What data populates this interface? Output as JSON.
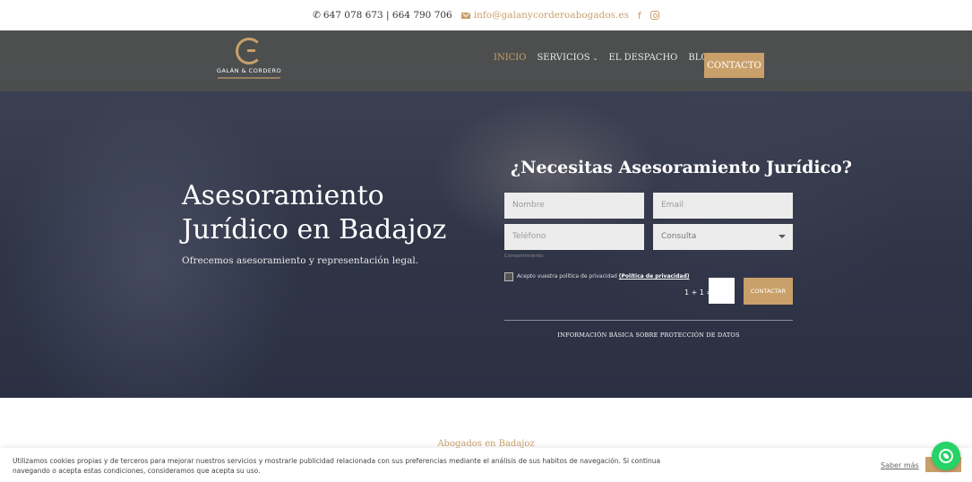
{
  "topbar": {
    "phone": "647 078 673 | 664 790 706",
    "email": "info@galanycorderoabogados.es",
    "facebook_icon": "f"
  },
  "logo": {
    "name": "GALÁN & CORDERO"
  },
  "nav": {
    "items": [
      {
        "label": "INICIO"
      },
      {
        "label": "SERVICIOS"
      },
      {
        "label": "EL DESPACHO"
      },
      {
        "label": "BLOG"
      }
    ],
    "contact_label": "CONTACTO",
    "chevron": "⌄"
  },
  "hero": {
    "title": "Asesoramiento Jurídico en Badajoz",
    "subtitle": "Ofrecemos asesoramiento y representación legal."
  },
  "form": {
    "title": "¿Necesitas Asesoramiento Jurídico?",
    "name_placeholder": "Nombre",
    "email_placeholder": "Email",
    "phone_placeholder": "Teléfono",
    "query_value": "Consulta",
    "consent_small": "Consentimiento",
    "consent_text": "Acepto vuestra política de privacidad",
    "consent_link": "(Política de privacidad)",
    "captcha_label": "1 + 1 =",
    "submit_label": "CONTACTAR",
    "privacy_info": "INFORMACIÓN BÁSICA SOBRE PROTECCIÓN DE DATOS"
  },
  "section": {
    "heading": "Abogados en Badajoz"
  },
  "cookie": {
    "text": "Utilizamos cookies propias y de terceros para mejorar nuestros servicios y mostrarle publicidad relacionada con sus preferencias mediante el análisis de sus habitos de navegación. Si continua navegando o acepta estas condiciones, consideramos que acepta su uso.",
    "more_label": "Saber más",
    "accept_label": "A"
  },
  "colors": {
    "accent": "#c9a06a",
    "nav_bg": "#50524e",
    "whatsapp": "#25d366"
  }
}
